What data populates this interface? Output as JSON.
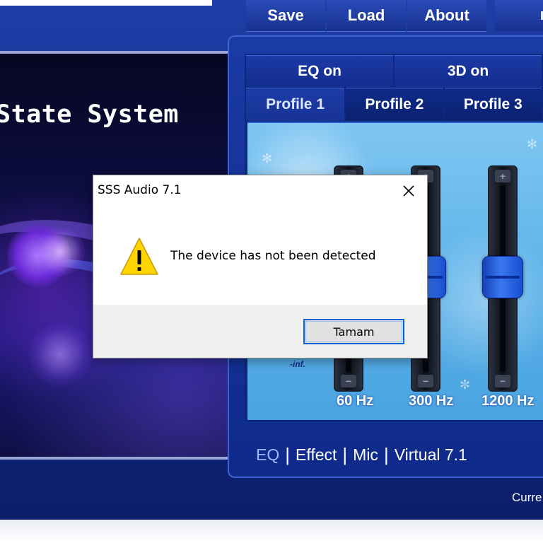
{
  "toolbar": {
    "buttons": [
      "Save",
      "Load",
      "About"
    ]
  },
  "banner": {
    "title": "State System"
  },
  "toggles": [
    "EQ on",
    "3D on"
  ],
  "profiles": [
    "Profile 1",
    "Profile 2",
    "Profile 3"
  ],
  "eq": {
    "min_label": "-inf.",
    "bands": [
      {
        "label": "60 Hz",
        "level": 0.5
      },
      {
        "label": "300 Hz",
        "level": 0.5
      },
      {
        "label": "1200 Hz",
        "level": 0.5
      }
    ]
  },
  "bottom_nav": {
    "items": [
      "EQ",
      "Effect",
      "Mic",
      "Virtual 7.1"
    ],
    "active": "EQ"
  },
  "status": {
    "text": "Curre"
  },
  "dialog": {
    "title": "SSS Audio 7.1",
    "message": "The device has not been detected",
    "ok_label": "Tamam"
  },
  "colors": {
    "app_background": "#112b86",
    "eq_background": "#5fb4ea",
    "slider_knob": "#2a5fe0",
    "dialog_focus_border": "#0a64d6",
    "warning_icon": "#ffd400"
  }
}
